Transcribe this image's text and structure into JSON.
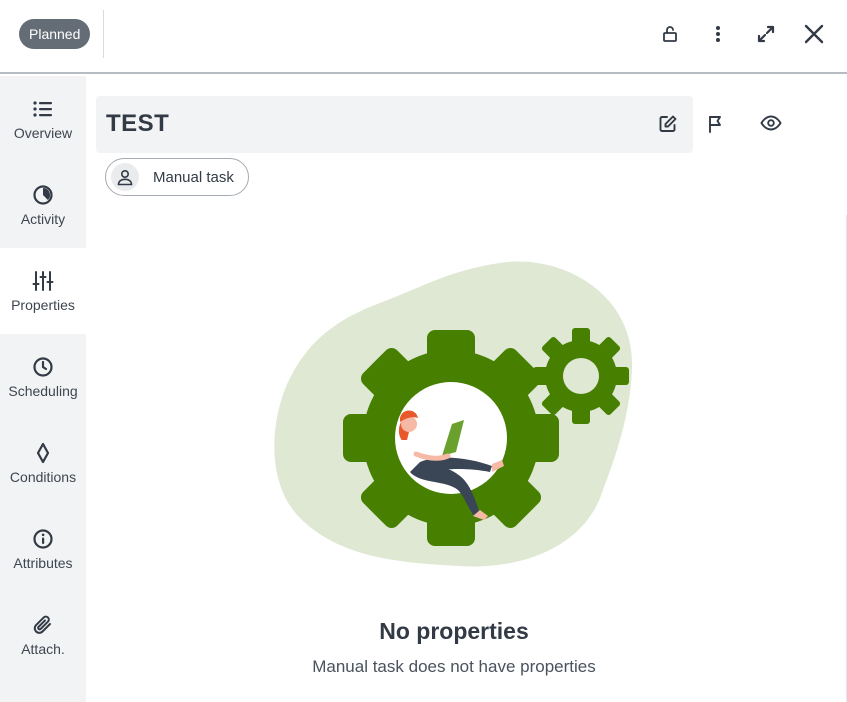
{
  "header": {
    "status_badge": "Planned",
    "icons": [
      "lock-open-icon",
      "more-vertical-icon",
      "expand-icon",
      "close-icon"
    ]
  },
  "sidebar": {
    "items": [
      {
        "label": "Overview",
        "icon": "list-icon",
        "active": false
      },
      {
        "label": "Activity",
        "icon": "pie-chart-icon",
        "active": false
      },
      {
        "label": "Properties",
        "icon": "sliders-icon",
        "active": true
      },
      {
        "label": "Scheduling",
        "icon": "clock-icon",
        "active": false
      },
      {
        "label": "Conditions",
        "icon": "diamond-icon",
        "active": false
      },
      {
        "label": "Attributes",
        "icon": "info-icon",
        "active": false
      },
      {
        "label": "Attach.",
        "icon": "paperclip-icon",
        "active": false
      }
    ]
  },
  "main": {
    "title": "TEST",
    "title_icons": [
      "edit-icon",
      "flag-icon",
      "eye-icon"
    ],
    "chip_label": "Manual task",
    "empty_state": {
      "title": "No properties",
      "subtitle": "Manual task does not have properties"
    }
  },
  "colors": {
    "badge_bg": "#646c76",
    "sidebar_bg": "#f2f3f4",
    "gear_green": "#478000",
    "blob_green": "#dfe8d3",
    "text": "#323a45"
  }
}
